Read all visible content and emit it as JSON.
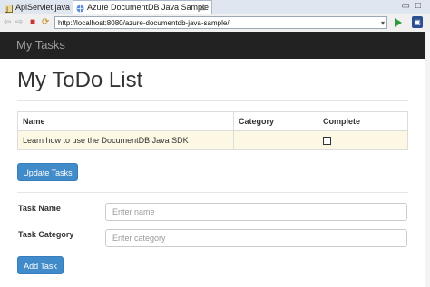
{
  "tabs": [
    {
      "label": "ApiServlet.java",
      "icon": "java-file-icon"
    },
    {
      "label": "Azure DocumentDB Java Sample",
      "icon": "browser-tab-icon",
      "close": "⊠"
    }
  ],
  "window_controls": {
    "minimize": "▭",
    "maximize": "□"
  },
  "toolbar": {
    "back": "⇦",
    "forward": "⇨",
    "stop": "■",
    "refresh": "⟳",
    "url": "http://localhost:8080/azure-documentdb-java-sample/",
    "url_dropdown": "▾",
    "external_browser": "▣"
  },
  "navbar": {
    "brand": "My Tasks"
  },
  "main": {
    "title": "My ToDo List",
    "table": {
      "headers": [
        "Name",
        "Category",
        "Complete"
      ],
      "rows": [
        {
          "name": "Learn how to use the DocumentDB Java SDK",
          "category": "",
          "complete": false
        }
      ]
    },
    "update_button": "Update Tasks",
    "form": {
      "task_name_label": "Task Name",
      "task_name_placeholder": "Enter name",
      "task_category_label": "Task Category",
      "task_category_placeholder": "Enter category",
      "add_button": "Add Task"
    }
  },
  "colors": {
    "primary_button": "#428bca",
    "navbar": "#222222",
    "row_highlight": "#fcf8e3"
  }
}
